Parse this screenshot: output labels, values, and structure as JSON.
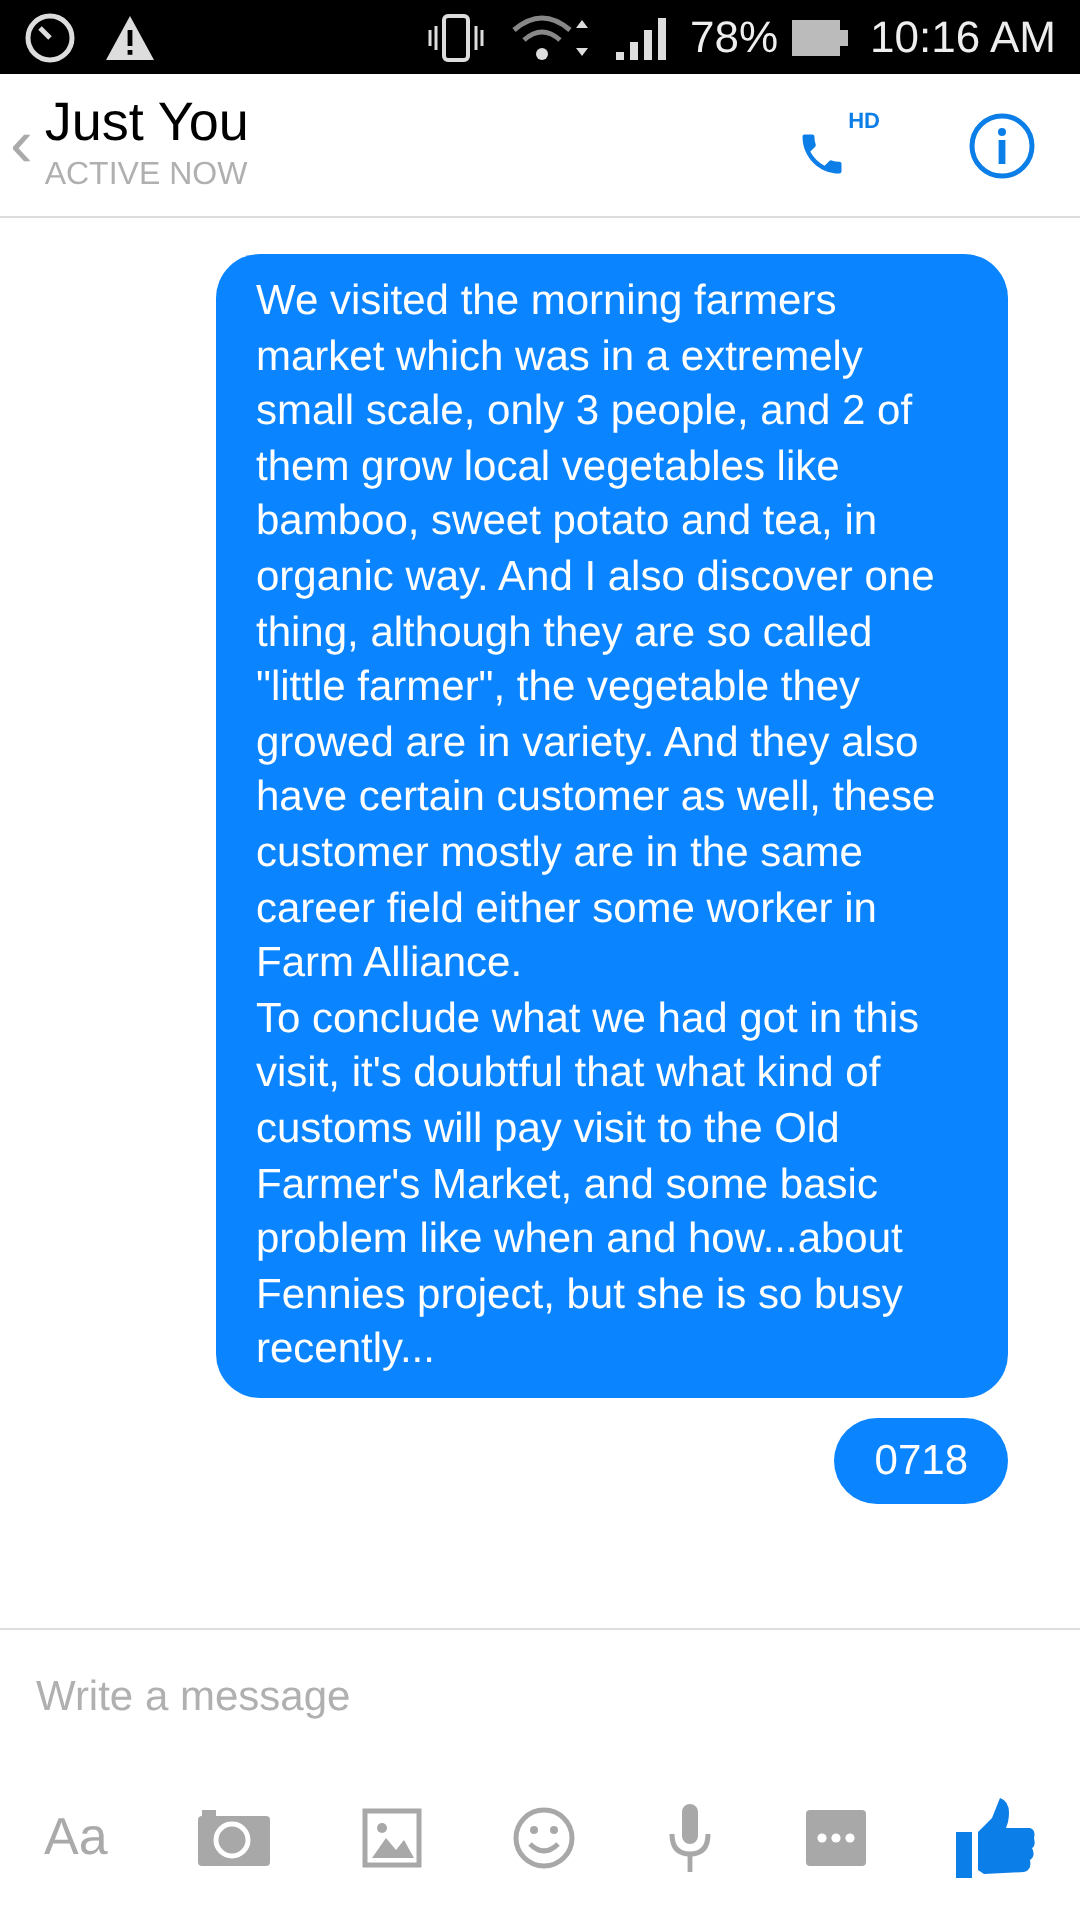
{
  "status_bar": {
    "battery": "78%",
    "time": "10:16 AM"
  },
  "header": {
    "back": "‹",
    "title": "Just You",
    "subtitle": "ACTIVE NOW",
    "call_badge": "HD"
  },
  "messages": [
    {
      "kind": "text",
      "paragraphs": [
        "We visited the morning farmers market which was in a extremely small scale, only 3 people, and 2 of them grow local vegetables like bamboo, sweet potato and tea, in organic way. And I also discover one thing, although they are so called \"little farmer\", the vegetable they growed are in variety. And they also have certain customer as well, these customer mostly are in the same career field either some worker in Farm Alliance.",
        "To conclude what we had got in this visit, it's doubtful that what kind of customs will pay visit to the Old Farmer's Market, and some basic problem like when and how...about Fennies project, but she is so busy recently..."
      ]
    },
    {
      "kind": "text",
      "paragraphs": [
        "0718"
      ]
    }
  ],
  "composer": {
    "placeholder": "Write a message",
    "text_button": "Aa"
  }
}
